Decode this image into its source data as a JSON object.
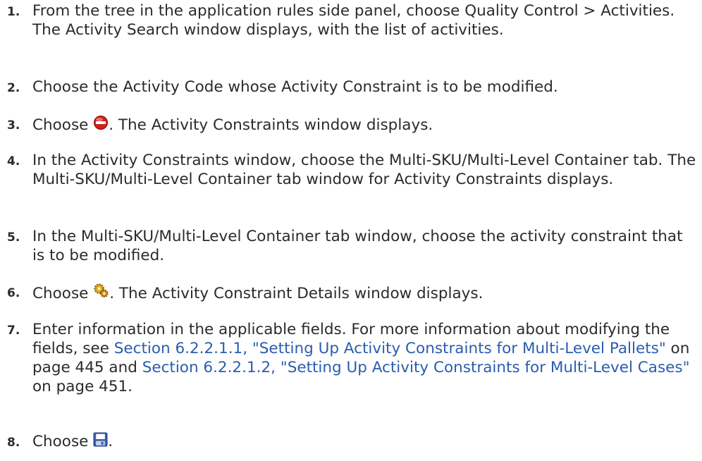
{
  "steps": [
    {
      "num": "1.",
      "text": "From the tree in the application rules side panel, choose Quality Control > Activities. The Activity Search window displays, with the list of activities."
    },
    {
      "num": "2.",
      "text": "Choose the Activity Code whose Activity Constraint is to be modified."
    },
    {
      "num": "3.",
      "pre": "Choose ",
      "icon": "delete-icon",
      "post": ". The Activity Constraints window displays."
    },
    {
      "num": "4.",
      "text": "In the Activity Constraints window, choose the Multi-SKU/Multi-Level Container tab. The Multi-SKU/Multi-Level Container tab window for Activity Constraints displays."
    },
    {
      "num": "5.",
      "text": "In the Multi-SKU/Multi-Level Container tab window, choose the activity constraint that is to be modified."
    },
    {
      "num": "6.",
      "pre": "Choose ",
      "icon": "gear-icon",
      "post": ". The Activity Constraint Details window displays."
    },
    {
      "num": "7.",
      "text_a": "Enter information in the applicable fields. For more information about modifying the fields, see ",
      "link1": "Section 6.2.2.1.1, \"Setting Up Activity Constraints for Multi-Level Pallets\"",
      "mid": " on page 445 and ",
      "link2": "Section 6.2.2.1.2, \"Setting Up Activity Constraints for Multi-Level Cases\"",
      "tail": " on page 451."
    },
    {
      "num": "8.",
      "pre": "Choose ",
      "icon": "save-icon",
      "post": "."
    }
  ],
  "colors": {
    "text": "#2b2b2b",
    "link": "#2a5db0"
  }
}
